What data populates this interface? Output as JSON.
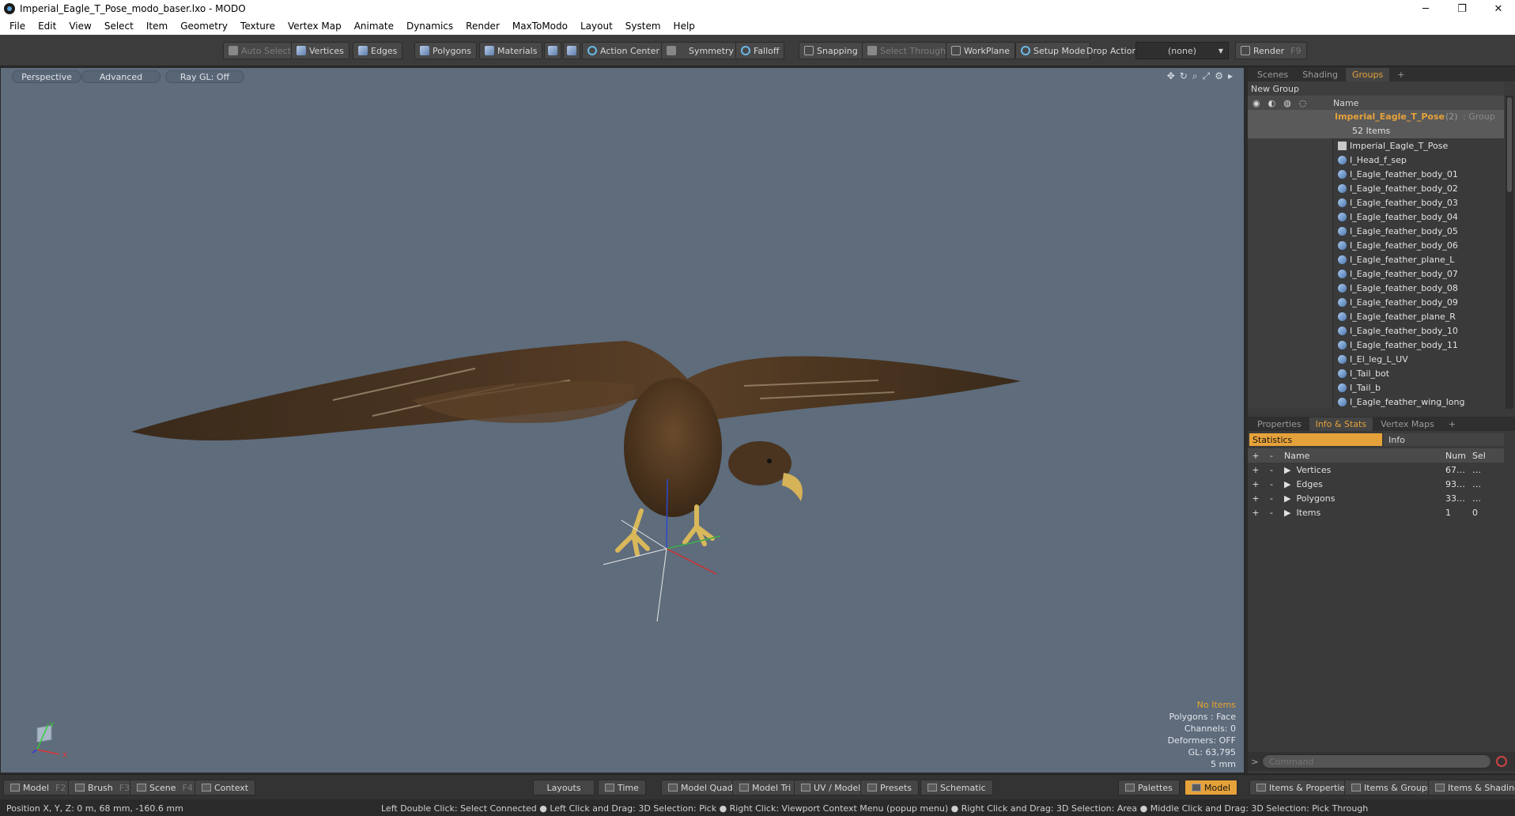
{
  "window": {
    "title": "Imperial_Eagle_T_Pose_modo_baser.lxo - MODO",
    "min": "─",
    "restore": "❐",
    "close": "✕"
  },
  "menu": [
    "File",
    "Edit",
    "View",
    "Select",
    "Item",
    "Geometry",
    "Texture",
    "Vertex Map",
    "Animate",
    "Dynamics",
    "Render",
    "MaxToModo",
    "Layout",
    "System",
    "Help"
  ],
  "toolbar": {
    "auto_select": "Auto Select",
    "vertices": "Vertices",
    "edges": "Edges",
    "polygons": "Polygons",
    "materials": "Materials",
    "action_center": "Action Center",
    "symmetry": "Symmetry",
    "falloff": "Falloff",
    "snapping": "Snapping",
    "select_through": "Select Through",
    "workplane": "WorkPlane",
    "setup_mode": "Setup Mode",
    "drop_action_label": "Drop Action",
    "drop_action_value": "(none)",
    "render": "Render",
    "render_key": "F9"
  },
  "viewport": {
    "tabs": [
      "Perspective",
      "Advanced",
      "Ray GL: Off"
    ],
    "hud": {
      "items": "No Items",
      "polygons": "Polygons : Face",
      "channels": "Channels: 0",
      "deformers": "Deformers: OFF",
      "gl": "GL: 63,795",
      "scale": "5 mm"
    },
    "gizmo": {
      "y": "Y",
      "x": "X"
    }
  },
  "groups_panel": {
    "tabs": [
      "Scenes",
      "Shading",
      "Groups"
    ],
    "active_tab": "Groups",
    "new_group": "New Group",
    "column_name": "Name",
    "group": {
      "name": "Imperial_Eagle_T_Pose",
      "count": "(2)",
      "type": ": Group",
      "items": "52 Items"
    },
    "items": [
      "Imperial_Eagle_T_Pose",
      "I_Head_f_sep",
      "I_Eagle_feather_body_01",
      "I_Eagle_feather_body_02",
      "I_Eagle_feather_body_03",
      "I_Eagle_feather_body_04",
      "I_Eagle_feather_body_05",
      "I_Eagle_feather_body_06",
      "I_Eagle_feather_plane_L",
      "I_Eagle_feather_body_07",
      "I_Eagle_feather_body_08",
      "I_Eagle_feather_body_09",
      "I_Eagle_feather_plane_R",
      "I_Eagle_feather_body_10",
      "I_Eagle_feather_body_11",
      "I_El_leg_L_UV",
      "I_Tail_bot",
      "I_Tail_b",
      "I_Eagle_feather_wing_long"
    ]
  },
  "stats_panel": {
    "tabs": [
      "Properties",
      "Info & Stats",
      "Vertex Maps"
    ],
    "active_tab": "Info & Stats",
    "sub_tabs": [
      "Statistics",
      "Info"
    ],
    "columns": {
      "name": "Name",
      "num": "Num",
      "sel": "Sel"
    },
    "rows": [
      {
        "name": "Vertices",
        "num": "67…",
        "sel": "…"
      },
      {
        "name": "Edges",
        "num": "93…",
        "sel": "…"
      },
      {
        "name": "Polygons",
        "num": "33…",
        "sel": "…"
      },
      {
        "name": "Items",
        "num": "1",
        "sel": "0"
      }
    ],
    "command_placeholder": "Command"
  },
  "bottombar": {
    "model": "Model",
    "model_key": "F2",
    "brush": "Brush",
    "brush_key": "F3",
    "scene": "Scene",
    "scene_key": "F4",
    "context": "Context",
    "layouts": "Layouts",
    "time": "Time",
    "model_quad": "Model Quad",
    "model_tri": "Model Tri",
    "uv_model": "UV / Model",
    "presets": "Presets",
    "schematic": "Schematic",
    "palettes": "Palettes",
    "model_active": "Model",
    "items_props": "Items & Properties",
    "items_groups": "Items & Groups",
    "items_shading": "Items & Shading"
  },
  "status": {
    "position": "Position X, Y, Z:   0 m, 68 mm, -160.6 mm",
    "hints": "Left Double Click: Select Connected ● Left Click and Drag: 3D Selection: Pick ● Right Click: Viewport Context Menu (popup menu) ● Right Click and Drag: 3D Selection: Area ● Middle Click and Drag: 3D Selection: Pick Through"
  },
  "colors": {
    "accent": "#e6a23a",
    "viewport_bg": "#5e6c7c",
    "panel_bg": "#3a3a3a"
  }
}
